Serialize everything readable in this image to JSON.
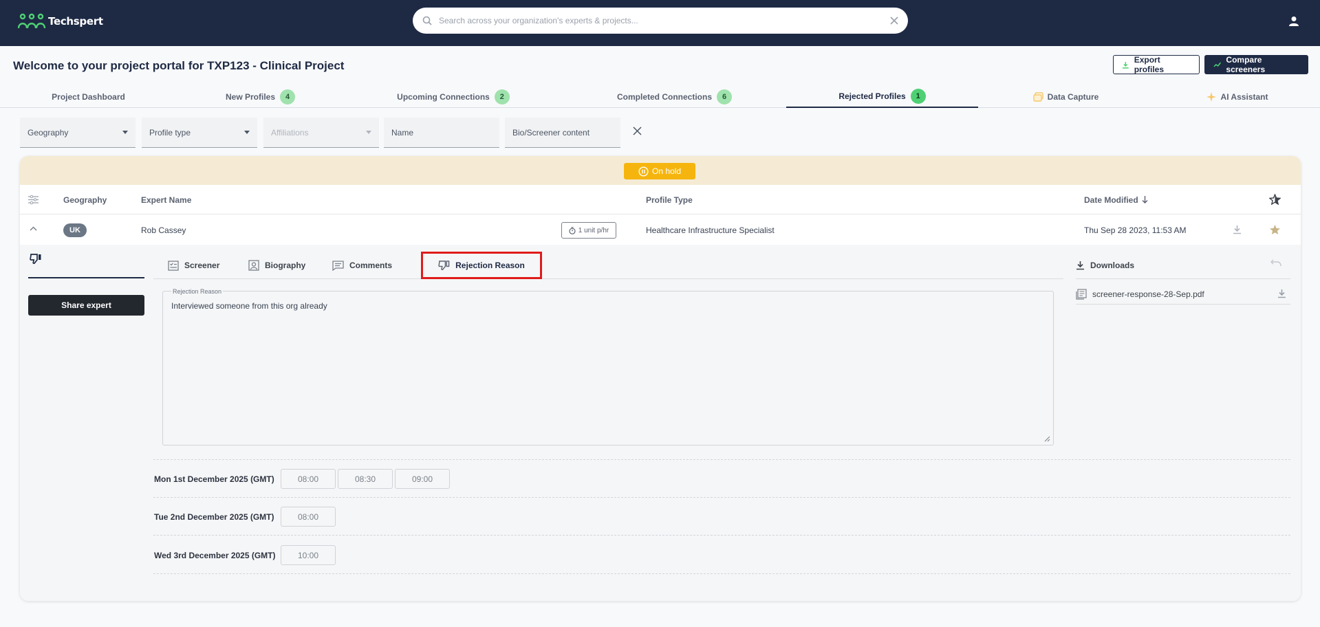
{
  "app": {
    "brand": "Techspert",
    "search_placeholder": "Search across your organization's experts & projects..."
  },
  "page": {
    "title": "Welcome to your project portal for TXP123 - Clinical Project",
    "export_label": "Export profiles",
    "compare_label": "Compare screeners"
  },
  "tabs": [
    {
      "label": "Project Dashboard"
    },
    {
      "label": "New Profiles",
      "count": "4"
    },
    {
      "label": "Upcoming Connections",
      "count": "2"
    },
    {
      "label": "Completed Connections",
      "count": "6"
    },
    {
      "label": "Rejected Profiles",
      "count": "1",
      "active": true
    },
    {
      "label": "Data Capture"
    },
    {
      "label": "AI Assistant"
    }
  ],
  "filters": {
    "geography": "Geography",
    "profile_type": "Profile type",
    "affiliations": "Affiliations",
    "name": "Name",
    "bio": "Bio/Screener content"
  },
  "status_banner": "On hold",
  "table": {
    "headers": {
      "geography": "Geography",
      "expert_name": "Expert Name",
      "profile_type": "Profile Type",
      "date_modified": "Date Modified"
    },
    "row": {
      "geography": "UK",
      "name": "Rob Cassey",
      "unit": "1 unit p/hr",
      "profile_type": "Healthcare Infrastructure Specialist",
      "date": "Thu Sep 28 2023, 11:53 AM"
    }
  },
  "detail": {
    "share_label": "Share expert",
    "tabs": [
      "Screener",
      "Biography",
      "Comments",
      "Rejection Reason"
    ],
    "reason_label": "Rejection Reason",
    "reason_text": "Interviewed someone from this org already",
    "downloads_label": "Downloads",
    "file_name": "screener-response-28-Sep.pdf",
    "availability": [
      {
        "date": "Mon 1st December 2025 (GMT)",
        "slots": [
          "08:00",
          "08:30",
          "09:00"
        ]
      },
      {
        "date": "Tue 2nd December 2025 (GMT)",
        "slots": [
          "08:00"
        ]
      },
      {
        "date": "Wed 3rd December 2025 (GMT)",
        "slots": [
          "10:00"
        ]
      }
    ]
  },
  "colors": {
    "navy": "#1e2a44",
    "badge_green": "#9fe2ad",
    "on_hold": "#f6b50e",
    "highlight_red": "#e01b1b"
  }
}
